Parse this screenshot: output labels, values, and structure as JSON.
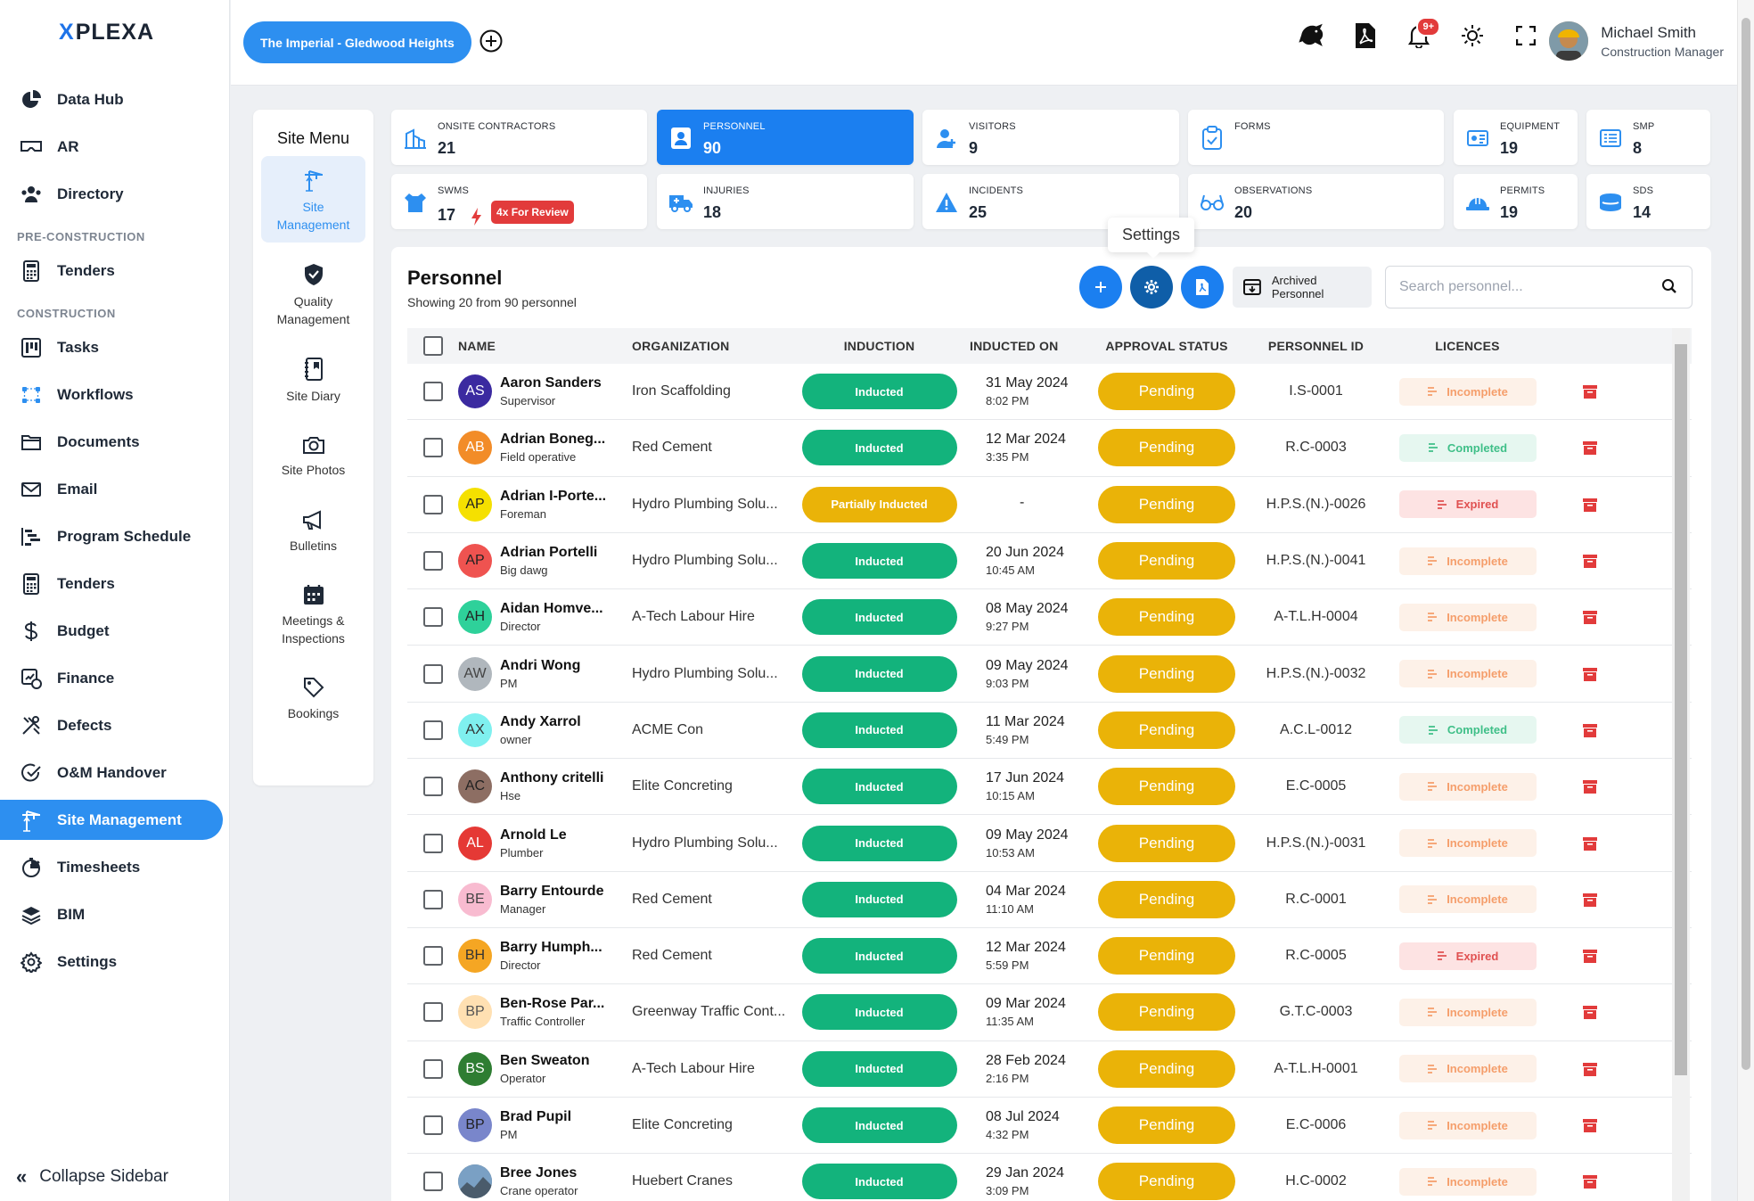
{
  "app": {
    "logo_mark": "X",
    "logo_text": "PLEXA",
    "site_name": "The Imperial - Gledwood Heights",
    "notifications": "9+",
    "user": {
      "name": "Michael Smith",
      "role": "Construction Manager"
    },
    "collapse_label": "Collapse Sidebar"
  },
  "sidebar": {
    "items": [
      {
        "label": "Data Hub",
        "icon": "pie-chart-icon"
      },
      {
        "label": "AR",
        "icon": "vr-headset-icon"
      },
      {
        "label": "Directory",
        "icon": "people-icon"
      },
      {
        "section": "PRE-CONSTRUCTION"
      },
      {
        "label": "Tenders",
        "icon": "calculator-icon"
      },
      {
        "section": "CONSTRUCTION"
      },
      {
        "label": "Tasks",
        "icon": "kanban-icon"
      },
      {
        "label": "Workflows",
        "icon": "workflow-icon"
      },
      {
        "label": "Documents",
        "icon": "folder-icon"
      },
      {
        "label": "Email",
        "icon": "envelope-icon"
      },
      {
        "label": "Program Schedule",
        "icon": "gantt-icon"
      },
      {
        "label": "Tenders",
        "icon": "calculator-icon"
      },
      {
        "label": "Budget",
        "icon": "dollar-icon"
      },
      {
        "label": "Finance",
        "icon": "finance-icon"
      },
      {
        "label": "Defects",
        "icon": "tools-icon"
      },
      {
        "label": "O&M Handover",
        "icon": "check-circle-icon"
      },
      {
        "label": "Site Management",
        "icon": "crane-icon",
        "active": true
      },
      {
        "label": "Timesheets",
        "icon": "stopwatch-icon"
      },
      {
        "label": "BIM",
        "icon": "layers-icon"
      },
      {
        "label": "Settings",
        "icon": "gear-icon"
      }
    ]
  },
  "site_menu": {
    "title": "Site Menu",
    "items": [
      {
        "label": "Site Management",
        "icon": "crane-icon",
        "active": true
      },
      {
        "label": "Quality Management",
        "icon": "shield-check-icon"
      },
      {
        "label": "Site Diary",
        "icon": "diary-icon"
      },
      {
        "label": "Site Photos",
        "icon": "camera-icon"
      },
      {
        "label": "Bulletins",
        "icon": "megaphone-icon"
      },
      {
        "label": "Meetings & Inspections",
        "icon": "calendar-icon"
      },
      {
        "label": "Bookings",
        "icon": "tag-icon"
      }
    ]
  },
  "stats": {
    "onsite_contractors": {
      "label": "ONSITE CONTRACTORS",
      "value": "21"
    },
    "personnel": {
      "label": "PERSONNEL",
      "value": "90"
    },
    "visitors": {
      "label": "VISITORS",
      "value": "9"
    },
    "forms": {
      "label": "FORMS",
      "value": ""
    },
    "equipment": {
      "label": "EQUIPMENT",
      "value": "19"
    },
    "smp": {
      "label": "SMP",
      "value": "8"
    },
    "swms": {
      "label": "SWMS",
      "value": "17",
      "badge": "4x For Review"
    },
    "injuries": {
      "label": "INJURIES",
      "value": "18"
    },
    "incidents": {
      "label": "INCIDENTS",
      "value": "25"
    },
    "observations": {
      "label": "OBSERVATIONS",
      "value": "20"
    },
    "permits": {
      "label": "PERMITS",
      "value": "19"
    },
    "sds": {
      "label": "SDS",
      "value": "14"
    }
  },
  "personnel": {
    "title": "Personnel",
    "subtitle": "Showing 20 from 90 personnel",
    "tooltip": "Settings",
    "archived_label": "Archived Personnel",
    "search_placeholder": "Search personnel...",
    "columns": [
      "NAME",
      "ORGANIZATION",
      "INDUCTION",
      "INDUCTED ON",
      "APPROVAL STATUS",
      "PERSONNEL ID",
      "LICENCES"
    ],
    "rows": [
      {
        "initials": "AS",
        "color": "#3b2aa0",
        "fg": "#ffffff",
        "name": "Aaron Sanders",
        "role": "Supervisor",
        "org": "Iron Scaffolding",
        "induction": "Inducted",
        "date": "31 May 2024",
        "time": "8:02 PM",
        "approval": "Pending",
        "pid": "I.S-0001",
        "licence": "Incomplete"
      },
      {
        "initials": "AB",
        "color": "#f28c28",
        "fg": "#ffffff",
        "name": "Adrian Boneg...",
        "role": "Field operative",
        "org": "Red Cement",
        "induction": "Inducted",
        "date": "12 Mar 2024",
        "time": "3:35 PM",
        "approval": "Pending",
        "pid": "R.C-0003",
        "licence": "Completed"
      },
      {
        "initials": "AP",
        "color": "#f5e000",
        "fg": "#222222",
        "name": "Adrian I-Porte...",
        "role": "Foreman",
        "org": "Hydro Plumbing Solu...",
        "induction": "Partially Inducted",
        "date": "-",
        "time": "",
        "approval": "Pending",
        "pid": "H.P.S.(N.)-0026",
        "licence": "Expired"
      },
      {
        "initials": "AP",
        "color": "#ef5350",
        "fg": "#222222",
        "name": "Adrian Portelli",
        "role": "Big dawg",
        "org": "Hydro Plumbing Solu...",
        "induction": "Inducted",
        "date": "20 Jun 2024",
        "time": "10:45 AM",
        "approval": "Pending",
        "pid": "H.P.S.(N.)-0041",
        "licence": "Incomplete"
      },
      {
        "initials": "AH",
        "color": "#2ed19a",
        "fg": "#222222",
        "name": "Aidan Homve...",
        "role": "Director",
        "org": "A-Tech Labour Hire",
        "induction": "Inducted",
        "date": "08 May 2024",
        "time": "9:27 PM",
        "approval": "Pending",
        "pid": "A-T.L.H-0004",
        "licence": "Incomplete"
      },
      {
        "initials": "AW",
        "color": "#b0b7bd",
        "fg": "#444444",
        "name": "Andri Wong",
        "role": "PM",
        "org": "Hydro Plumbing Solu...",
        "induction": "Inducted",
        "date": "09 May 2024",
        "time": "9:03 PM",
        "approval": "Pending",
        "pid": "H.P.S.(N.)-0032",
        "licence": "Incomplete"
      },
      {
        "initials": "AX",
        "color": "#7ff0ef",
        "fg": "#333333",
        "name": "Andy Xarrol",
        "role": "owner",
        "org": "ACME Con",
        "induction": "Inducted",
        "date": "11 Mar 2024",
        "time": "5:49 PM",
        "approval": "Pending",
        "pid": "A.C.L-0012",
        "licence": "Completed"
      },
      {
        "initials": "AC",
        "color": "#8d6e63",
        "fg": "#222222",
        "name": "Anthony critelli",
        "role": "Hse",
        "org": "Elite Concreting",
        "induction": "Inducted",
        "date": "17 Jun 2024",
        "time": "10:15 AM",
        "approval": "Pending",
        "pid": "E.C-0005",
        "licence": "Incomplete"
      },
      {
        "initials": "AL",
        "color": "#e53935",
        "fg": "#ffffff",
        "name": "Arnold Le",
        "role": "Plumber",
        "org": "Hydro Plumbing Solu...",
        "induction": "Inducted",
        "date": "09 May 2024",
        "time": "10:53 AM",
        "approval": "Pending",
        "pid": "H.P.S.(N.)-0031",
        "licence": "Incomplete"
      },
      {
        "initials": "BE",
        "color": "#f8bbd0",
        "fg": "#444444",
        "name": "Barry Entourde",
        "role": "Manager",
        "org": "Red Cement",
        "induction": "Inducted",
        "date": "04 Mar 2024",
        "time": "11:10 AM",
        "approval": "Pending",
        "pid": "R.C-0001",
        "licence": "Incomplete"
      },
      {
        "initials": "BH",
        "color": "#f5a623",
        "fg": "#333333",
        "name": "Barry Humph...",
        "role": "Director",
        "org": "Red Cement",
        "induction": "Inducted",
        "date": "12 Mar 2024",
        "time": "5:59 PM",
        "approval": "Pending",
        "pid": "R.C-0005",
        "licence": "Expired"
      },
      {
        "initials": "BP",
        "color": "#ffe0b2",
        "fg": "#555555",
        "name": "Ben-Rose Par...",
        "role": "Traffic Controller",
        "org": "Greenway Traffic Cont...",
        "induction": "Inducted",
        "date": "09 Mar 2024",
        "time": "11:35 AM",
        "approval": "Pending",
        "pid": "G.T.C-0003",
        "licence": "Incomplete"
      },
      {
        "initials": "BS",
        "color": "#2e7d32",
        "fg": "#ffffff",
        "name": "Ben Sweaton",
        "role": "Operator",
        "org": "A-Tech Labour Hire",
        "induction": "Inducted",
        "date": "28 Feb 2024",
        "time": "2:16 PM",
        "approval": "Pending",
        "pid": "A-T.L.H-0001",
        "licence": "Incomplete"
      },
      {
        "initials": "BP",
        "color": "#7986cb",
        "fg": "#222222",
        "name": "Brad Pupil",
        "role": "PM",
        "org": "Elite Concreting",
        "induction": "Inducted",
        "date": "08 Jul 2024",
        "time": "4:32 PM",
        "approval": "Pending",
        "pid": "E.C-0006",
        "licence": "Incomplete"
      },
      {
        "initials": "",
        "color": "#546e7a",
        "fg": "#ffffff",
        "name": "Bree Jones",
        "role": "Crane operator",
        "org": "Huebert Cranes",
        "induction": "Inducted",
        "date": "29 Jan 2024",
        "time": "3:09 PM",
        "approval": "Pending",
        "pid": "H.C-0002",
        "licence": "Incomplete"
      }
    ]
  }
}
